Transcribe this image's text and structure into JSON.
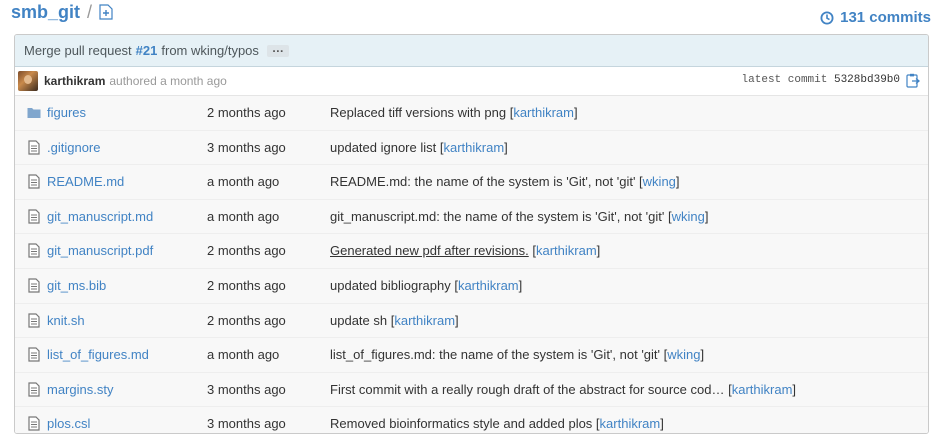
{
  "header": {
    "repo_name": "smb_git",
    "separator": "/",
    "commits_label": "131 commits"
  },
  "latest_commit": {
    "message_prefix": "Merge pull request",
    "pr_number": "#21",
    "message_suffix": "from wking/typos",
    "ellipsis": "…",
    "author": "karthikram",
    "authored_text": "authored a month ago",
    "latest_label": "latest commit",
    "sha": "5328bd39b0"
  },
  "files": [
    {
      "type": "folder",
      "name": "figures",
      "age": "2 months ago",
      "message": "Replaced tiff versions with png",
      "underline": false,
      "user": "karthikram"
    },
    {
      "type": "file",
      "name": ".gitignore",
      "age": "3 months ago",
      "message": "updated ignore list",
      "underline": false,
      "user": "karthikram"
    },
    {
      "type": "file",
      "name": "README.md",
      "age": "a month ago",
      "message": "README.md: the name of the system is 'Git', not 'git'",
      "underline": false,
      "user": "wking"
    },
    {
      "type": "file",
      "name": "git_manuscript.md",
      "age": "a month ago",
      "message": "git_manuscript.md: the name of the system is 'Git', not 'git'",
      "underline": false,
      "user": "wking"
    },
    {
      "type": "file",
      "name": "git_manuscript.pdf",
      "age": "2 months ago",
      "message": "Generated new pdf after revisions.",
      "underline": true,
      "user": "karthikram"
    },
    {
      "type": "file",
      "name": "git_ms.bib",
      "age": "2 months ago",
      "message": "updated bibliography",
      "underline": false,
      "user": "karthikram"
    },
    {
      "type": "file",
      "name": "knit.sh",
      "age": "2 months ago",
      "message": "update sh",
      "underline": false,
      "user": "karthikram"
    },
    {
      "type": "file",
      "name": "list_of_figures.md",
      "age": "a month ago",
      "message": "list_of_figures.md: the name of the system is 'Git', not 'git'",
      "underline": false,
      "user": "wking"
    },
    {
      "type": "file",
      "name": "margins.sty",
      "age": "3 months ago",
      "message": "First commit with a really rough draft of the abstract for source cod…",
      "underline": false,
      "user": "karthikram"
    },
    {
      "type": "file",
      "name": "plos.csl",
      "age": "3 months ago",
      "message": "Removed bioinformatics style and added plos",
      "underline": false,
      "user": "karthikram"
    }
  ],
  "colors": {
    "link": "#4183c4",
    "title_bg": "#e6f1f6",
    "rows_bg": "#f8f8f8",
    "folder": "#80a6cd"
  }
}
